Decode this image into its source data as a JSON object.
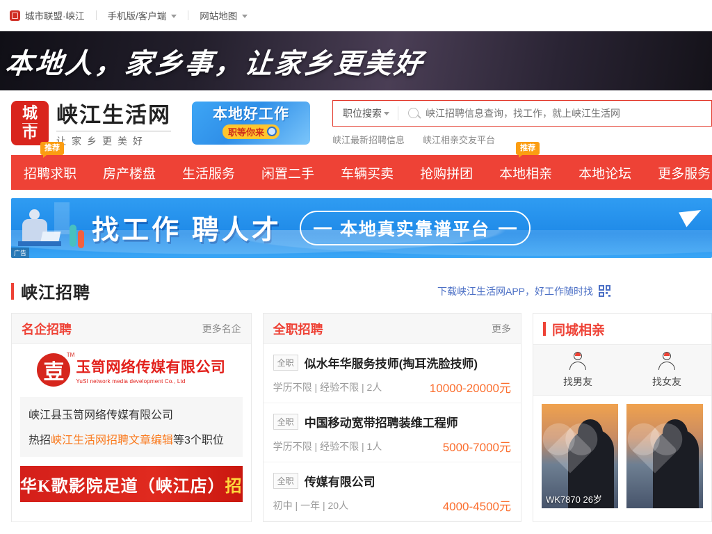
{
  "topbar": {
    "brand": "城市联盟·峡江",
    "items": [
      {
        "label": "手机版/客户端",
        "icon": "chevron-down-icon"
      },
      {
        "label": "网站地图",
        "icon": "chevron-down-icon"
      }
    ]
  },
  "slogan": {
    "text": "本地人，家乡事，让家乡更美好"
  },
  "header": {
    "logo": {
      "stamp_top": "城",
      "stamp_bottom": "市",
      "main": "峡江生活网",
      "sub": "让家乡更美好"
    },
    "ad": {
      "line1": "本地好工作",
      "line2": "职等你来"
    },
    "search": {
      "category": "职位搜索",
      "placeholder": "峡江招聘信息查询，找工作，就上峡江生活网",
      "value": ""
    },
    "hot_links": [
      "峡江最新招聘信息",
      "峡江相亲交友平台"
    ]
  },
  "nav": {
    "items": [
      {
        "label": "招聘求职",
        "badge": "推荐"
      },
      {
        "label": "房产楼盘",
        "badge": ""
      },
      {
        "label": "生活服务",
        "badge": ""
      },
      {
        "label": "闲置二手",
        "badge": ""
      },
      {
        "label": "车辆买卖",
        "badge": ""
      },
      {
        "label": "抢购拼团",
        "badge": ""
      },
      {
        "label": "本地相亲",
        "badge": "推荐"
      },
      {
        "label": "本地论坛",
        "badge": ""
      },
      {
        "label": "更多服务",
        "badge": ""
      }
    ]
  },
  "job_banner": {
    "title": "找工作 聘人才",
    "pill": "本地真实靠谱平台",
    "ad_flag": "广告"
  },
  "section": {
    "title": "峡江招聘",
    "app_link": "下载峡江生活网APP，好工作随时找"
  },
  "famous_companies": {
    "title": "名企招聘",
    "more": "更多名企",
    "company": {
      "logo_cn": "玉笥网络传媒有限公司",
      "logo_en": "YuSI  network media development Co., Ltd",
      "name": "峡江县玉笥网络传媒有限公司",
      "hot_prefix": "热招",
      "hot_job": "峡江生活网招聘文章编辑",
      "hot_suffix": "等3个职位"
    },
    "banner2": {
      "text_white": "华K歌影院足道（峡江店）",
      "text_yellow": "招"
    }
  },
  "fulltime": {
    "title": "全职招聘",
    "more": "更多",
    "jobs": [
      {
        "tag": "全职",
        "title": "似水年华服务技师(掏耳洗脸技师)",
        "meta": "学历不限 | 经验不限 | 2人",
        "salary": "10000-20000元"
      },
      {
        "tag": "全职",
        "title": "中国移动宽带招聘装维工程师",
        "meta": "学历不限 | 经验不限 | 1人",
        "salary": "5000-7000元"
      },
      {
        "tag": "全职",
        "title": "传媒有限公司",
        "meta": "初中 | 一年 | 20人",
        "salary": "4000-4500元"
      }
    ]
  },
  "matchmaking": {
    "title": "同城相亲",
    "tabs": [
      {
        "label": "找男友",
        "icon": "person-icon"
      },
      {
        "label": "找女友",
        "icon": "person-icon"
      }
    ],
    "cards": [
      {
        "caption": "WK7870 26岁"
      },
      {
        "caption": ""
      }
    ]
  },
  "colors": {
    "brand_red": "#ee4236",
    "accent_orange": "#fb6e2e",
    "badge_orange": "#fb9d12",
    "link_blue": "#4b6fc5",
    "banner_blue": "#2f9cf2"
  }
}
